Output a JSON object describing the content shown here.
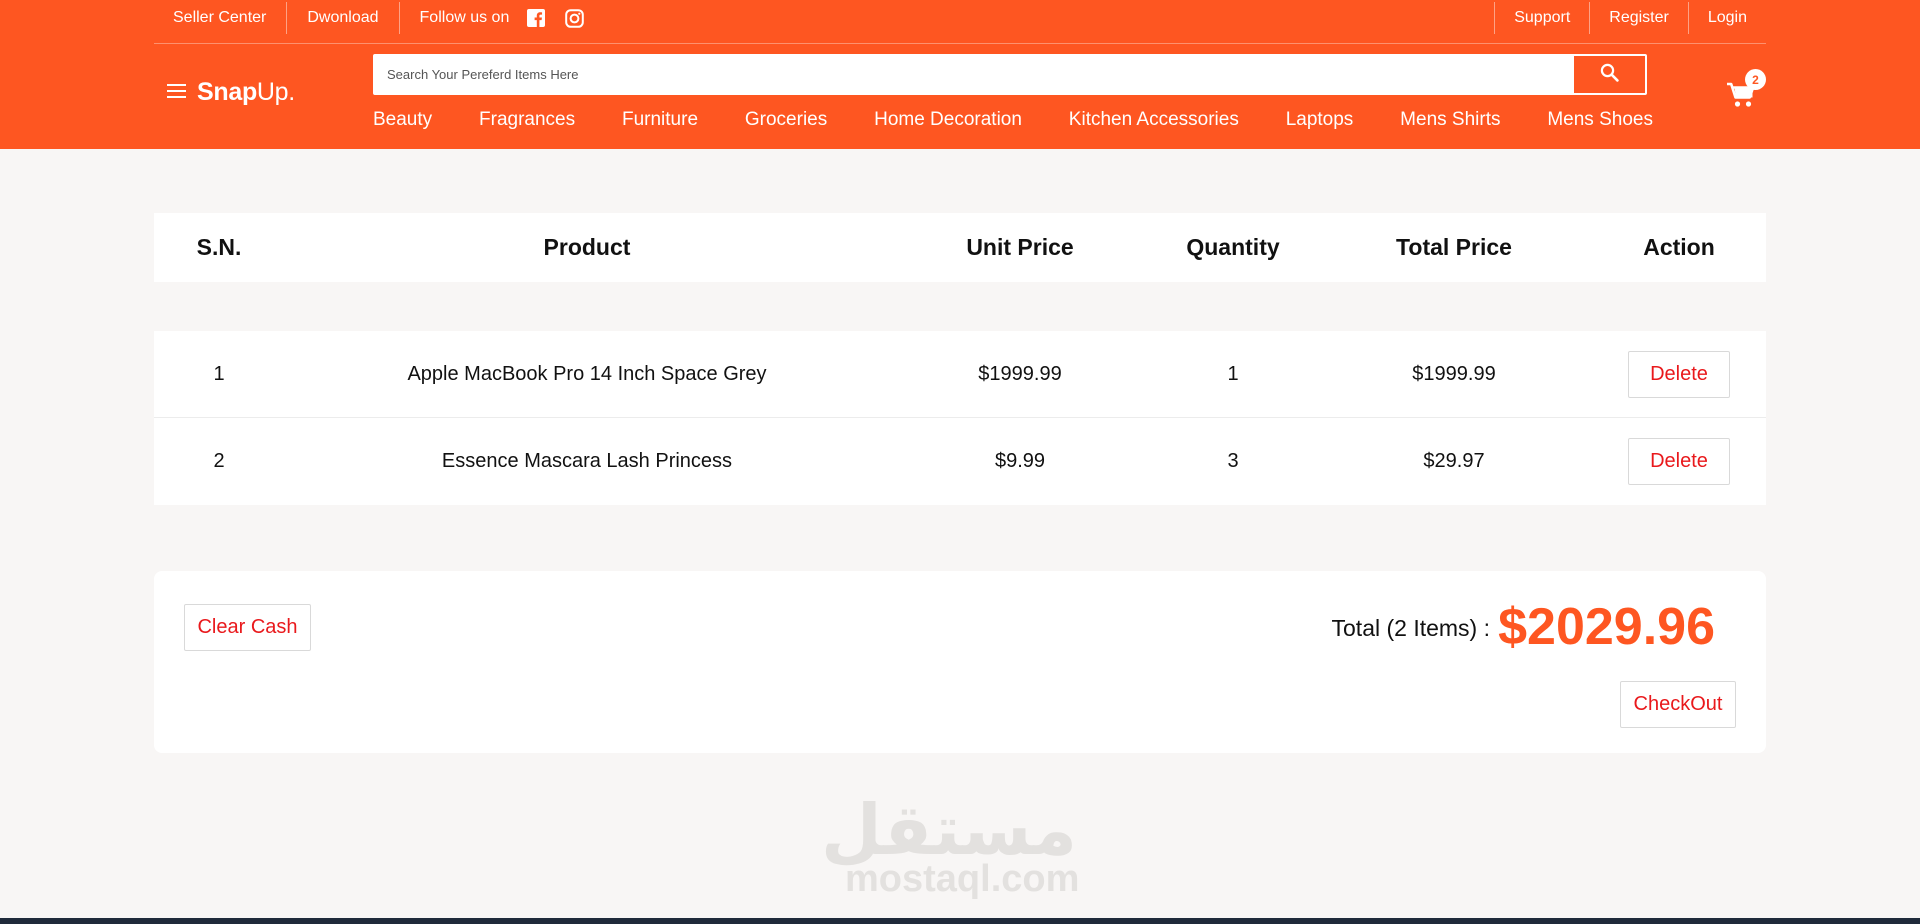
{
  "topbar": {
    "left_links": [
      "Seller Center",
      "Dwonload"
    ],
    "follow_label": "Follow us on",
    "social_icons": [
      "facebook-icon",
      "instagram-icon"
    ],
    "right_links": [
      "Support",
      "Register",
      "Login"
    ]
  },
  "brand": {
    "logo_bold": "Snap",
    "logo_regular": "Up."
  },
  "search": {
    "placeholder": "Search Your Pereferd Items Here",
    "value": ""
  },
  "categories": [
    "Beauty",
    "Fragrances",
    "Furniture",
    "Groceries",
    "Home Decoration",
    "Kitchen Accessories",
    "Laptops",
    "Mens Shirts",
    "Mens Shoes"
  ],
  "cart": {
    "count": "2"
  },
  "table": {
    "headers": [
      "S.N.",
      "Product",
      "Unit Price",
      "Quantity",
      "Total Price",
      "Action"
    ],
    "rows": [
      {
        "sn": "1",
        "product": "Apple MacBook Pro 14 Inch Space Grey",
        "unit_price": "$1999.99",
        "quantity": "1",
        "total_price": "$1999.99",
        "action": "Delete"
      },
      {
        "sn": "2",
        "product": "Essence Mascara Lash Princess",
        "unit_price": "$9.99",
        "quantity": "3",
        "total_price": "$29.97",
        "action": "Delete"
      }
    ]
  },
  "summary": {
    "clear_label": "Clear Cash",
    "total_label": "Total (2 Items) :",
    "total_amount": "$2029.96",
    "checkout_label": "CheckOut"
  },
  "watermark": {
    "arabic": "مستقل",
    "latin": "mostaql.com"
  },
  "colors": {
    "brand": "#fe5621",
    "danger_text": "#e9191c",
    "page_bg": "#f8f6f5"
  }
}
